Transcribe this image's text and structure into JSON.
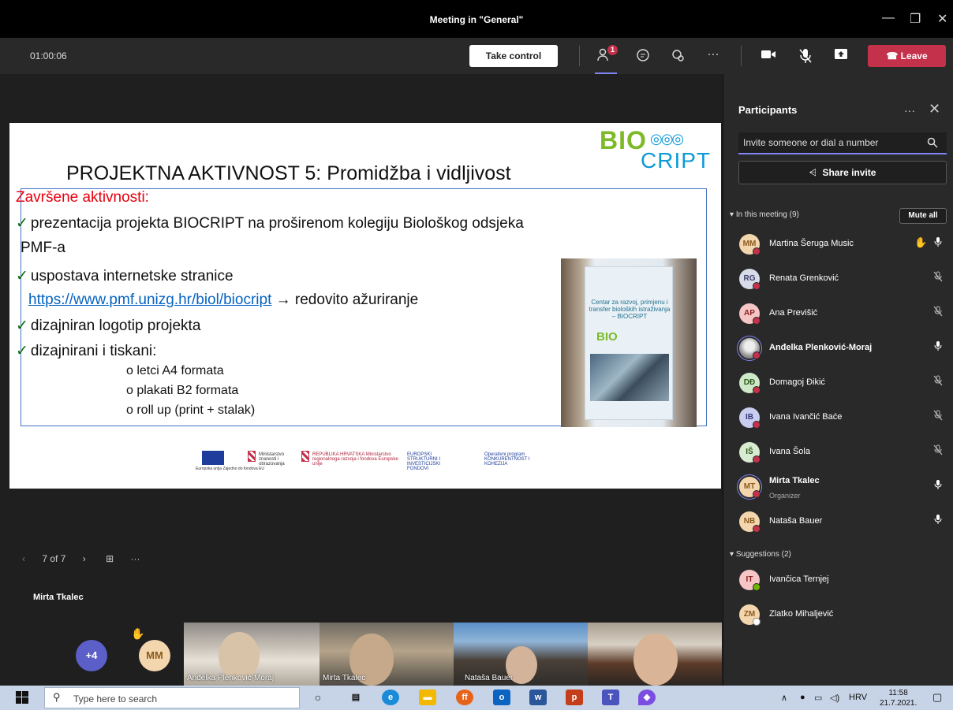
{
  "window": {
    "title": "Meeting in \"General\"",
    "minimize": "—",
    "maximize": "❐",
    "close": "✕"
  },
  "toolbar": {
    "timer": "01:00:06",
    "take_control": "Take control",
    "participants_badge": "1",
    "leave": "Leave",
    "icons": [
      "people-icon",
      "chat-icon",
      "reactions-icon",
      "more-icon",
      "camera-icon",
      "mic-off-icon",
      "share-icon",
      "phone-icon"
    ]
  },
  "slide": {
    "title": "PROJEKTNA AKTIVNOST 5: Promidžba i vidljivost",
    "logo_top": "BIO",
    "logo_bottom": "CRIPT",
    "section_title": "Završene aktivnosti:",
    "check": "✓",
    "lines": [
      "prezentacija projekta BIOCRIPT na proširenom kolegiju Biološkog odsjeka",
      "PMF-a",
      "uspostava internetske stranice",
      "dizajniran logotip projekta",
      "dizajnirani i tiskani:"
    ],
    "link": "https://www.pmf.unizg.hr/biol/biocript",
    "link_suffix": " → redovito ažuriranje",
    "sub_items": [
      "o letci A4 formata",
      "o plakati B2 formata",
      "o roll up (print + stalak)"
    ],
    "rollup_text": "Centar za razvoj, primjenu i transfer bioloških istraživanja – BIOCRIPT",
    "rollup_logo": "BIO",
    "footer_logos": [
      "Europska unija Zajedno do fondova EU",
      "Ministarstvo znanosti i obrazovanja",
      "REPUBLIKA HRVATSKA Ministarstvo regionalnoga razvoja i fondova Europske unije",
      "EUROPSKI STRUKTURNI I INVESTICIJSKI FONDOVI",
      "Operativni program KONKURENTNOST I KOHEZIJA"
    ]
  },
  "pager": {
    "position": "7 of 7",
    "prev": "‹",
    "next": "›",
    "grid": "⊞",
    "more": "···"
  },
  "presenter": "Mirta Tkalec",
  "video_strip": {
    "more_count": "+4",
    "mm_initials": "MM",
    "tiles": [
      "Anđelka Plenković-Moraj",
      "Mirta Tkalec",
      "Nataša Bauer",
      ""
    ]
  },
  "panel": {
    "title": "Participants",
    "more": "···",
    "close": "✕",
    "invite_placeholder": "Invite someone or dial a number",
    "share_invite": "Share invite",
    "in_meeting_header": "In this meeting (9)",
    "mute_all": "Mute all",
    "participants": [
      {
        "initials": "MM",
        "name": "Martina Šeruga Music",
        "color": "#f4d6ae",
        "text_color": "#8a5a1e",
        "mic": "on",
        "hand": true
      },
      {
        "initials": "RG",
        "name": "Renata Grenković",
        "color": "#d8dbe8",
        "text_color": "#3b3f6d",
        "mic": "off"
      },
      {
        "initials": "AP",
        "name": "Ana Previšić",
        "color": "#f6c6c6",
        "text_color": "#8a2020",
        "mic": "off"
      },
      {
        "initials": "",
        "name": "Anđelka Plenković-Moraj",
        "color": "#cfcfcf",
        "text_color": "#333",
        "mic": "on",
        "photo": true
      },
      {
        "initials": "DĐ",
        "name": "Domagoj Đikić",
        "color": "#cfe8c7",
        "text_color": "#2e5a1e",
        "mic": "off"
      },
      {
        "initials": "IB",
        "name": "Ivana Ivančić Baće",
        "color": "#c9cdf0",
        "text_color": "#32367a",
        "mic": "off"
      },
      {
        "initials": "IŠ",
        "name": "Ivana Šola",
        "color": "#d7ecd0",
        "text_color": "#2e5a1e",
        "mic": "off"
      },
      {
        "initials": "MT",
        "name": "Mirta Tkalec",
        "subtitle": "Organizer",
        "color": "#f4d6ae",
        "text_color": "#8a5a1e",
        "mic": "on",
        "ring": true
      },
      {
        "initials": "NB",
        "name": "Nataša Bauer",
        "color": "#f4d6ae",
        "text_color": "#8a5a1e",
        "mic": "on"
      }
    ],
    "suggestions_header": "Suggestions (2)",
    "suggestions": [
      {
        "initials": "IT",
        "name": "Ivančica Ternjej",
        "color": "#f6c6c6",
        "text_color": "#8a2020"
      },
      {
        "initials": "ZM",
        "name": "Zlatko Mihaljević",
        "color": "#f4d6ae",
        "text_color": "#8a5a1e"
      }
    ]
  },
  "taskbar": {
    "search_placeholder": "Type here to search",
    "lang": "HRV",
    "time": "11:58",
    "date": "21.7.2021."
  }
}
